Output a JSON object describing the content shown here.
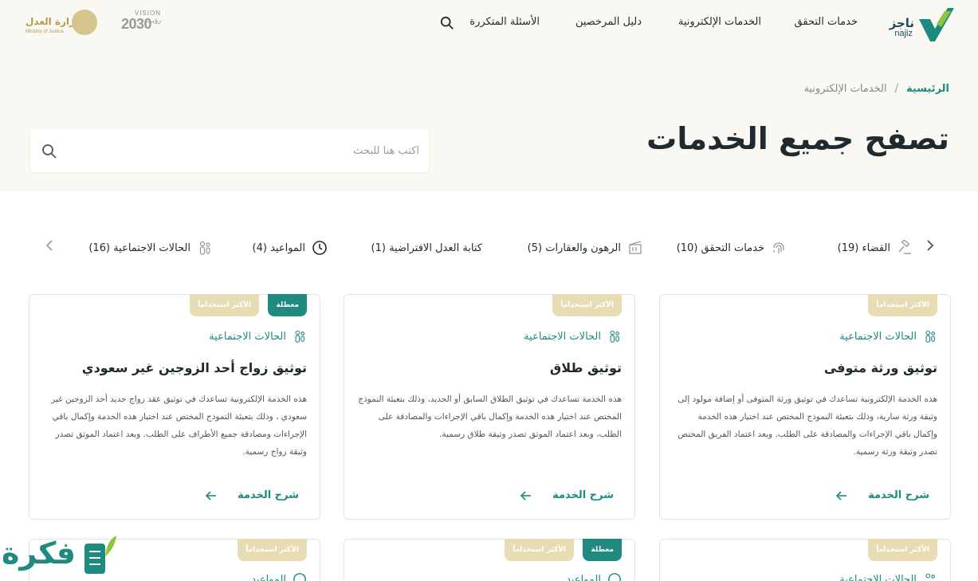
{
  "header": {
    "brand_name": "ناجز",
    "brand_latin": "najiz",
    "nav": [
      {
        "label": "خدمات التحقق"
      },
      {
        "label": "الخدمات الإلكترونية"
      },
      {
        "label": "دليل المرخصين"
      },
      {
        "label": "الأسئلة المتكررة"
      }
    ],
    "vision_small": "VISION رؤيـــة",
    "vision_year": "2030",
    "ministry_name": "وزارة العدل",
    "ministry_latin": "Ministry of Justice"
  },
  "hero": {
    "breadcrumb": {
      "home": "الرئيسية",
      "separator": "/",
      "current": "الخدمات الإلكترونية"
    },
    "title": "تصفح جميع الخدمات",
    "search": {
      "placeholder": "اكتب هنا للبحث"
    }
  },
  "categories": [
    {
      "label": "القضاء (19)",
      "icon": "gavel-icon"
    },
    {
      "label": "خدمات التحقق (10)",
      "icon": "fingerprint-icon"
    },
    {
      "label": "الرهون والعقارات (5)",
      "icon": "building-icon"
    },
    {
      "label": "كتابة العدل الافتراضية (1)",
      "icon": "none"
    },
    {
      "label": "المواعيد (4)",
      "icon": "clock-icon"
    },
    {
      "label": "الحالات الاجتماعية (16)",
      "icon": "family-icon"
    }
  ],
  "cards": [
    {
      "badge_most": "الأكثر استخداماً",
      "badge_disabled": "",
      "category": "الحالات الاجتماعية",
      "title": "توثيق ورثة متوفى",
      "description": "هذه الخدمة الإلكترونية تساعدك في توثيق ورثة المتوفى أو إضافة مولود إلى وثيقة ورثة سارية، وذلك بتعبئة النموذج المختص عند اختيار هذه الخدمة وإكمال باقي الإجراءات والمصادقة على الطلب. وبعد اعتماد الفريق المختص تصدر وثيقة ورثة رسمية.",
      "link": "شرح الخدمة"
    },
    {
      "badge_most": "الأكثر استخداماً",
      "badge_disabled": "",
      "category": "الحالات الاجتماعية",
      "title": "توثيق طلاق",
      "description": "هذه الخدمة تساعدك في توثيق الطلاق السابق أو الجديد، وذلك بتعبئة النموذج المختص عند اختيار هذه الخدمة وإكمال باقي الإجراءات والمصادقة على الطلب، وبعد اعتماد الموثق تصدر وثيقة طلاق رسمية.",
      "link": "شرح الخدمة"
    },
    {
      "badge_most": "الأكثر استخداماً",
      "badge_disabled": "معطلة",
      "category": "الحالات الاجتماعية",
      "title": "توثيق زواج أحد الزوجين غير سعودي",
      "description": "هذه الخدمة الإلكترونية تساعدك في توثيق عقد زواج جديد أحد الزوجين غير سعودي ، وذلك بتعبئة النموذج المختص عند اختيار هذه الخدمة وإكمال باقي الإجراءات ومصادقة جميع الأطراف على الطلب. وبعد اعتماد الموثق تصدر وثيقة زواج رسمية.",
      "link": "شرح الخدمة"
    },
    {
      "badge_most": "الأكثر استخداماً",
      "badge_disabled": "",
      "category": "الحالات الاجتماعية"
    },
    {
      "badge_most": "الأكثر استخداماً",
      "badge_disabled": "معطلة",
      "category": "المواعيد"
    },
    {
      "badge_most": "الأكثر استخداماً",
      "badge_disabled": "",
      "category": "المواعيد"
    }
  ],
  "watermark": {
    "text": "فكرة"
  },
  "colors": {
    "primary": "#1b8a80",
    "badge_gold": "#e7dcb4",
    "hero_bg": "#faf8f2",
    "text_dark": "#1f2a2e"
  }
}
